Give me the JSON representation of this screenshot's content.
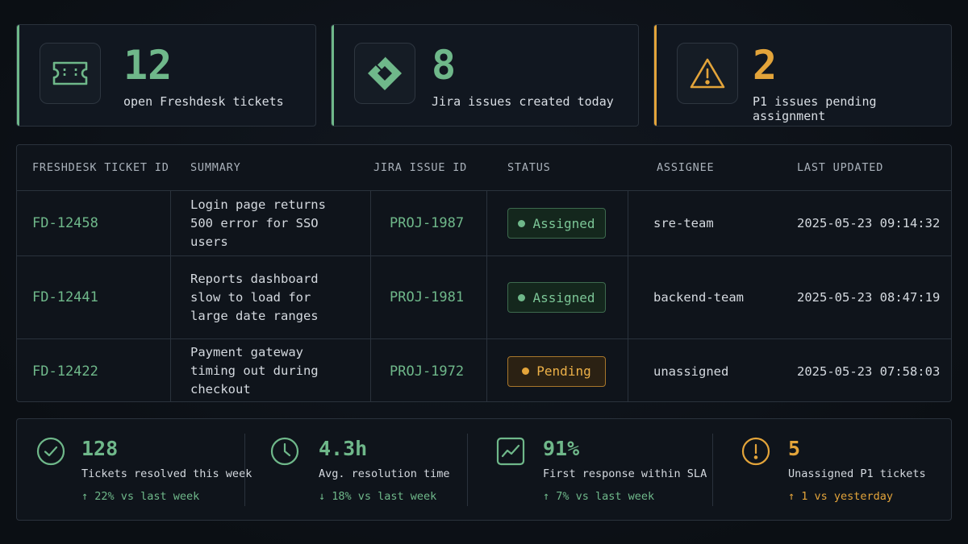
{
  "kpis": [
    {
      "value": "12",
      "label": "open Freshdesk tickets",
      "icon": "ticket-icon"
    },
    {
      "value": "8",
      "label": "Jira issues created today",
      "icon": "jira-icon"
    },
    {
      "value": "2",
      "label": "P1 issues pending assignment",
      "icon": "warning-icon"
    }
  ],
  "table": {
    "headers": [
      "FRESHDESK TICKET ID",
      "SUMMARY",
      "JIRA ISSUE ID",
      "STATUS",
      "ASSIGNEE",
      "LAST UPDATED"
    ],
    "rows": [
      {
        "ticket_id": "FD-12458",
        "summary": "Login page returns 500 error for SSO users",
        "jira_id": "PROJ-1987",
        "status": "Assigned",
        "assignee": "sre-team",
        "updated": "2025-05-23 09:14:32"
      },
      {
        "ticket_id": "FD-12441",
        "summary": "Reports dashboard slow to load for large date ranges",
        "jira_id": "PROJ-1981",
        "status": "Assigned",
        "assignee": "backend-team",
        "updated": "2025-05-23 08:47:19"
      },
      {
        "ticket_id": "FD-12422",
        "summary": "Payment gateway timing out during checkout",
        "jira_id": "PROJ-1972",
        "status": "Pending",
        "assignee": "unassigned",
        "updated": "2025-05-23 07:58:03"
      }
    ]
  },
  "stats": [
    {
      "value": "128",
      "label": "Tickets resolved this week",
      "trend": "↑ 22% vs last week",
      "icon": "check-circle-icon"
    },
    {
      "value": "4.3h",
      "label": "Avg. resolution time",
      "trend": "↓ 18% vs last week",
      "icon": "clock-icon"
    },
    {
      "value": "91%",
      "label": "First response within SLA",
      "trend": "↑ 7% vs last week",
      "icon": "trend-chart-icon"
    },
    {
      "value": "5",
      "label": "Unassigned P1 tickets",
      "trend": "↑ 1 vs yesterday",
      "icon": "alert-circle-icon"
    }
  ],
  "colors": {
    "accent_green": "#6fb88a",
    "accent_orange": "#e3a43a",
    "background": "#0d1117"
  }
}
